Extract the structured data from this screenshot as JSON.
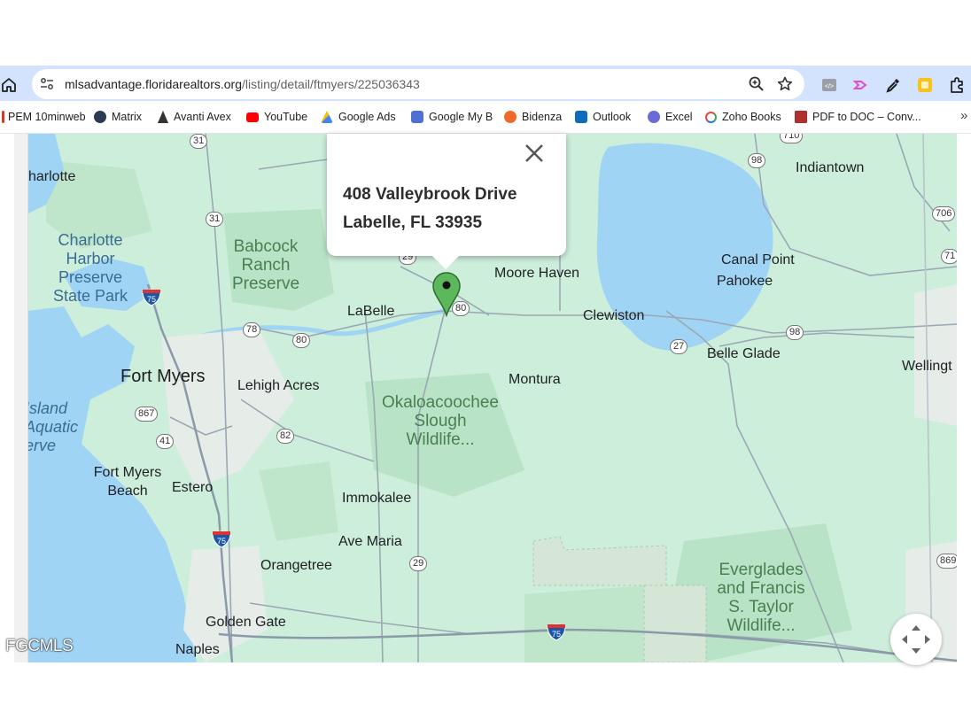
{
  "browser": {
    "url_host": "mlsadvantage.floridarealtors.org",
    "url_path": "/listing/detail/ftmyers/225036343",
    "bookmarks": [
      {
        "label": "PEM 10minweb",
        "color": "#d23a2a"
      },
      {
        "label": "Matrix",
        "color": "#2b3b55"
      },
      {
        "label": "Avanti Avex",
        "color": "#333333"
      },
      {
        "label": "YouTube",
        "color": "#ff0000"
      },
      {
        "label": "Google Ads",
        "color": "#fbbc04"
      },
      {
        "label": "Google My B",
        "color": "#4f6fd1"
      },
      {
        "label": "Bidenza",
        "color": "#f06a2a"
      },
      {
        "label": "Outlook",
        "color": "#0f6cbd"
      },
      {
        "label": "Excel",
        "color": "#6b6bd6"
      },
      {
        "label": "Zoho Books",
        "color": "#e04a3a"
      },
      {
        "label": "PDF to DOC – Conv...",
        "color": "#b03030"
      }
    ],
    "more_bookmarks": "»"
  },
  "map": {
    "popup": {
      "line1": "408 Valleybrook Drive",
      "line2": "Labelle, FL 33935"
    },
    "labels": {
      "charlotte": "harlotte",
      "charlotte_harbor": "Charlotte\nHarbor\nPreserve\nState Park",
      "babcock": "Babcock\nRanch\nPreserve",
      "labelle": "LaBelle",
      "moore_haven": "Moore Haven",
      "clewiston": "Clewiston",
      "indiantown": "Indiantown",
      "canal_point": "Canal Point",
      "pahokee": "Pahokee",
      "belle_glade": "Belle Glade",
      "wellington": "Wellingt",
      "fort_myers": "Fort Myers",
      "lehigh": "Lehigh Acres",
      "montura": "Montura",
      "okaloacoochee": "Okaloacoochee\nSlough\nWildlife...",
      "island_aquatic": "Island\nAquatic\nerve",
      "fort_myers_beach": "Fort Myers\nBeach",
      "estero": "Estero",
      "immokalee": "Immokalee",
      "ave_maria": "Ave Maria",
      "orangetree": "Orangetree",
      "everglades": "Everglades\nand Francis\nS. Taylor\nWildlife...",
      "golden_gate": "Golden Gate",
      "naples": "Naples"
    },
    "shields": [
      "31",
      "31",
      "78",
      "80",
      "867",
      "41",
      "82",
      "29",
      "29",
      "80",
      "98",
      "98",
      "27",
      "706",
      "71",
      "869",
      "710"
    ],
    "interstates": [
      "75",
      "75",
      "75"
    ],
    "colors": {
      "water": "#9fd4f5",
      "land": "#cdeedb",
      "park": "#b5e3c4",
      "urban": "#e8ece9",
      "marker": "#5cb85c"
    }
  },
  "watermark": "FGCMLS"
}
